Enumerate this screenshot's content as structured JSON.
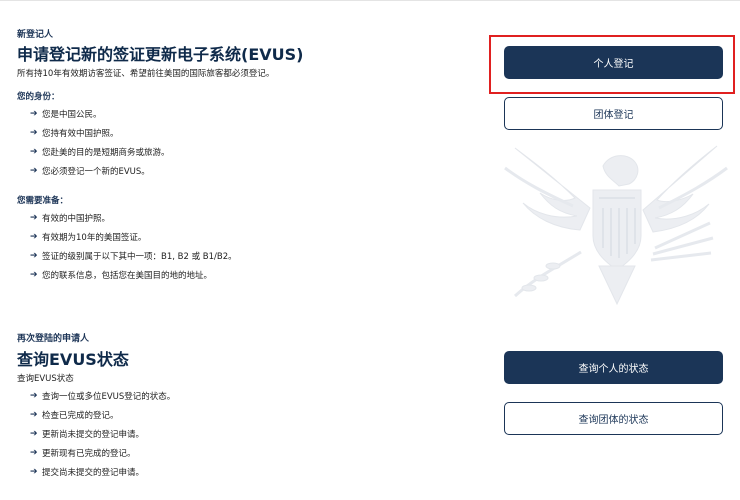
{
  "new_registrant": {
    "eyebrow": "新登记人",
    "title": "申请登记新的签证更新电子系统(EVUS)",
    "description": "所有持10年有效期访客签证、希望前往美国的国际旅客都必须登记。",
    "identity_heading": "您的身份：",
    "identity_items": [
      "您是中国公民。",
      "您持有效中国护照。",
      "您赴美的目的是短期商务或旅游。",
      "您必须登记一个新的EVUS。"
    ],
    "prepare_heading": "您需要准备：",
    "prepare_items": [
      "有效的中国护照。",
      "有效期为10年的美国签证。",
      "签证的级别属于以下其中一项：B1, B2 或 B1/B2。",
      "您的联系信息，包括您在美国目的地的地址。"
    ],
    "individual_button": "个人登记",
    "group_button": "团体登记"
  },
  "returning": {
    "eyebrow": "再次登陆的申请人",
    "title": "查询EVUS状态",
    "description": "查询EVUS状态",
    "items": [
      "查询一位或多位EVUS登记的状态。",
      "检查已完成的登记。",
      "更新尚未提交的登记申请。",
      "更新现有已完成的登记。",
      "提交尚未提交的登记申请。"
    ],
    "individual_status_button": "查询个人的状态",
    "group_status_button": "查询团体的状态"
  },
  "icons": {
    "bullet": "arrow-right-icon",
    "watermark": "eagle-seal-icon"
  },
  "colors": {
    "navy": "#1b3557",
    "highlight": "#e02020",
    "text": "#222222"
  }
}
